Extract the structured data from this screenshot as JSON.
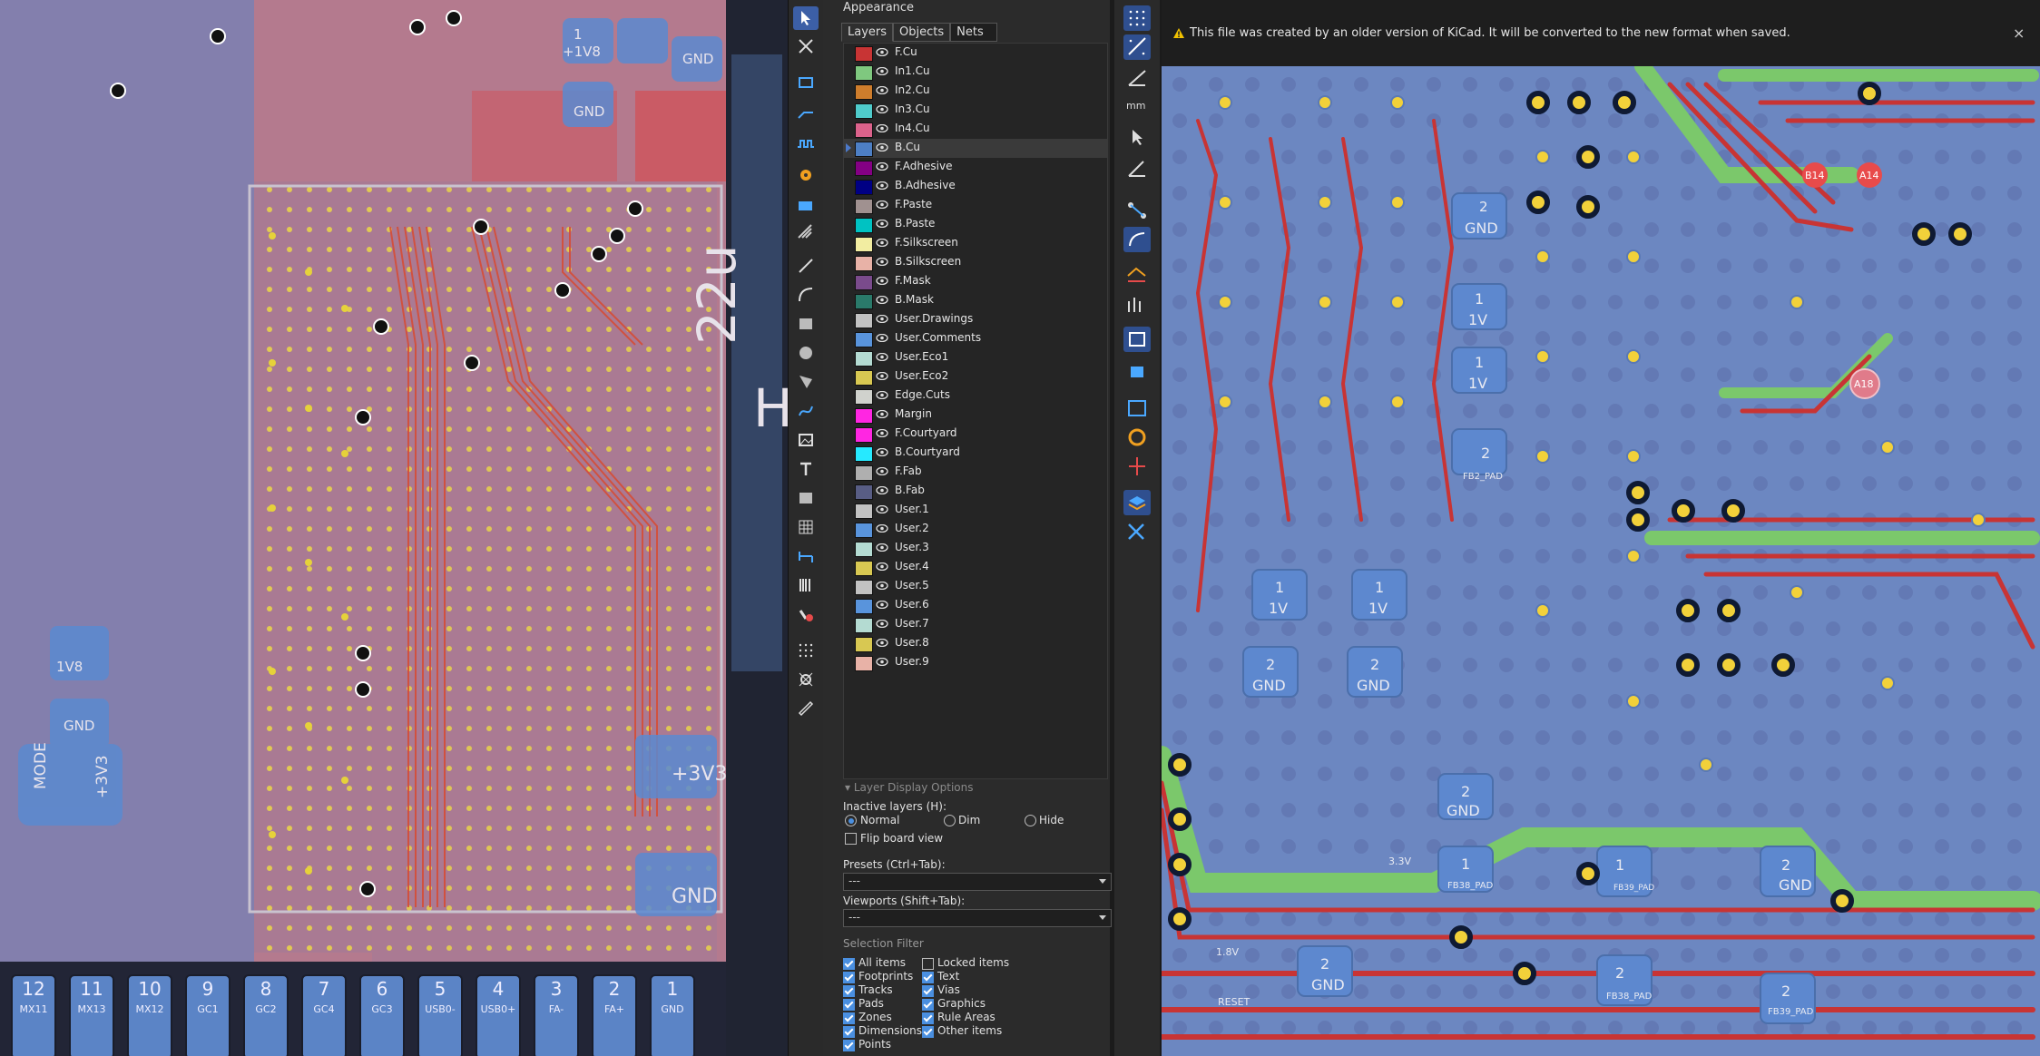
{
  "panel": {
    "title": "Appearance",
    "tabs": [
      "Layers",
      "Objects",
      "Nets"
    ],
    "layers": [
      {
        "name": "F.Cu",
        "color": "#c83434"
      },
      {
        "name": "In1.Cu",
        "color": "#7fc87f"
      },
      {
        "name": "In2.Cu",
        "color": "#ce7d2c"
      },
      {
        "name": "In3.Cu",
        "color": "#4fcbcb"
      },
      {
        "name": "In4.Cu",
        "color": "#db628b"
      },
      {
        "name": "B.Cu",
        "color": "#4d7fc4"
      },
      {
        "name": "F.Adhesive",
        "color": "#840084"
      },
      {
        "name": "B.Adhesive",
        "color": "#000084"
      },
      {
        "name": "F.Paste",
        "color": "#a09190"
      },
      {
        "name": "B.Paste",
        "color": "#00c2c2"
      },
      {
        "name": "F.Silkscreen",
        "color": "#f2eda1"
      },
      {
        "name": "B.Silkscreen",
        "color": "#e8b2a7"
      },
      {
        "name": "F.Mask",
        "color": "#7a4b8c"
      },
      {
        "name": "B.Mask",
        "color": "#2a7a6a"
      },
      {
        "name": "User.Drawings",
        "color": "#c2c2c2"
      },
      {
        "name": "User.Comments",
        "color": "#5994dc"
      },
      {
        "name": "User.Eco1",
        "color": "#b4dbd2"
      },
      {
        "name": "User.Eco2",
        "color": "#d8c852"
      },
      {
        "name": "Edge.Cuts",
        "color": "#d0d2cd"
      },
      {
        "name": "Margin",
        "color": "#ff26e2"
      },
      {
        "name": "F.Courtyard",
        "color": "#ff26e2"
      },
      {
        "name": "B.Courtyard",
        "color": "#26e9ff"
      },
      {
        "name": "F.Fab",
        "color": "#afafaf"
      },
      {
        "name": "B.Fab",
        "color": "#585d84"
      },
      {
        "name": "User.1",
        "color": "#c2c2c2"
      },
      {
        "name": "User.2",
        "color": "#5994dc"
      },
      {
        "name": "User.3",
        "color": "#b4dbd2"
      },
      {
        "name": "User.4",
        "color": "#d8c852"
      },
      {
        "name": "User.5",
        "color": "#c2c2c2"
      },
      {
        "name": "User.6",
        "color": "#5994dc"
      },
      {
        "name": "User.7",
        "color": "#b4dbd2"
      },
      {
        "name": "User.8",
        "color": "#d8c852"
      },
      {
        "name": "User.9",
        "color": "#e8b2a7"
      }
    ],
    "selected_layer": "B.Cu",
    "layer_display_options": "Layer Display Options",
    "inactive_layers_label": "Inactive layers (H):",
    "inactive_options": [
      "Normal",
      "Dim",
      "Hide"
    ],
    "inactive_selected": "Normal",
    "flip_board": "Flip board view",
    "presets_label": "Presets (Ctrl+Tab):",
    "presets_value": "---",
    "viewports_label": "Viewports (Shift+Tab):",
    "viewports_value": "---",
    "selection_filter": "Selection Filter",
    "filters_left": [
      "All items",
      "Footprints",
      "Tracks",
      "Pads",
      "Zones",
      "Dimensions",
      "Points"
    ],
    "filters_right": [
      "Locked items",
      "Text",
      "Vias",
      "Graphics",
      "Rule Areas",
      "Other items"
    ]
  },
  "banner": {
    "message": "This file was created by an older version of KiCad. It will be converted to the new format when saved.",
    "close": "×"
  },
  "left_canvas": {
    "labels": [
      "+1V8",
      "+1V8",
      "GND",
      "GND",
      "GND",
      "+3V3",
      "+3V3",
      "+1V8",
      "1V8",
      "GND",
      "GND",
      "MODE",
      "+3V3",
      "22u",
      "+3V3",
      "GND",
      "GND"
    ],
    "connectors": [
      {
        "num": "12",
        "name": "MX11"
      },
      {
        "num": "11",
        "name": "MX13"
      },
      {
        "num": "10",
        "name": "MX12"
      },
      {
        "num": "9",
        "name": "GC1"
      },
      {
        "num": "8",
        "name": "GC2"
      },
      {
        "num": "7",
        "name": "GC4"
      },
      {
        "num": "6",
        "name": "GC3"
      },
      {
        "num": "5",
        "name": "USB0-"
      },
      {
        "num": "4",
        "name": "USB0+"
      },
      {
        "num": "3",
        "name": "FA-"
      },
      {
        "num": "2",
        "name": "FA+"
      },
      {
        "num": "1",
        "name": "GND"
      }
    ]
  },
  "right_canvas": {
    "labels": [
      "GND",
      "1V",
      "1V",
      "1V",
      "FB2_PAD",
      "GND",
      "1V",
      "1V",
      "GND",
      "1.8V",
      "GND",
      "GND",
      "FB38_PAD",
      "FB39_PAD",
      "GND",
      "GND",
      "GND",
      "GND",
      "FB38_PAD",
      "FB39_PAD",
      "3.3V",
      "1.8V",
      "RESET",
      "A18",
      "B14",
      "A14"
    ]
  }
}
